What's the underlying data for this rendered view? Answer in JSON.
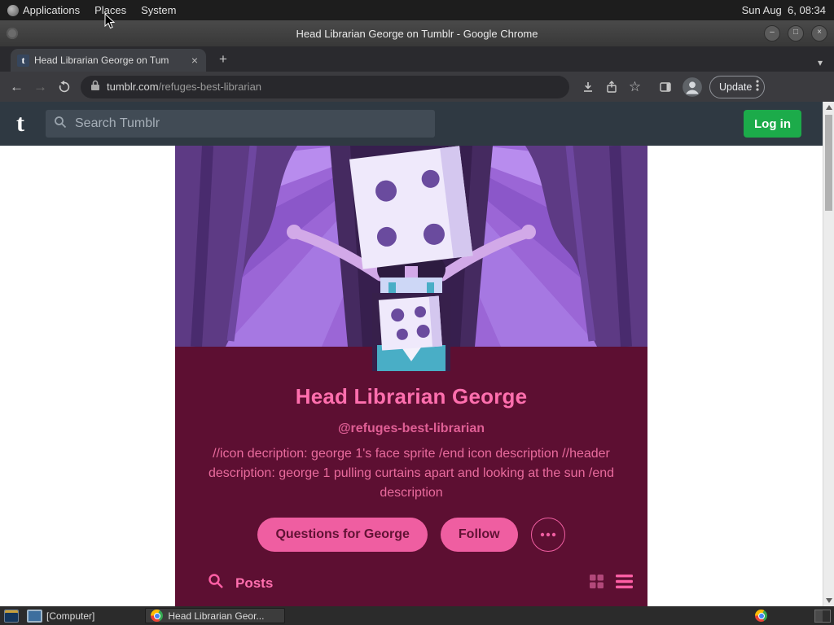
{
  "desktop": {
    "menubar": {
      "items": [
        "Applications",
        "Places",
        "System"
      ],
      "clock": "Sun Aug  6, 08:34"
    },
    "taskbar": {
      "computer_label": "[Computer]",
      "task_label": "Head Librarian Geor..."
    }
  },
  "chrome": {
    "window_title": "Head Librarian George on Tumblr - Google Chrome",
    "tab_title": "Head Librarian George on Tum",
    "url_host": "tumblr.com",
    "url_path": "/refuges-best-librarian",
    "update_label": "Update"
  },
  "tumblr": {
    "search_placeholder": "Search Tumblr",
    "login_label": "Log in",
    "blog_title": "Head Librarian George",
    "blog_handle": "@refuges-best-librarian",
    "description": "//icon decription: george 1's face sprite /end icon description //header description: george 1 pulling curtains apart and looking at the sun /end description",
    "ask_label": "Questions for George",
    "follow_label": "Follow",
    "posts_label": "Posts"
  },
  "icons": {
    "tumblr_logo": "t",
    "back": "←",
    "forward": "→",
    "close": "×",
    "new_tab": "+",
    "chevron_down": "▾",
    "bookmark_star": "☆",
    "minimize": "–",
    "maximize": "□",
    "window_close": "×"
  },
  "colors": {
    "tumblr_green": "#1cab4a",
    "blog_background": "#5d0f32",
    "blog_pink": "#ef5ea1",
    "banner_purple": "#9b66d6"
  }
}
